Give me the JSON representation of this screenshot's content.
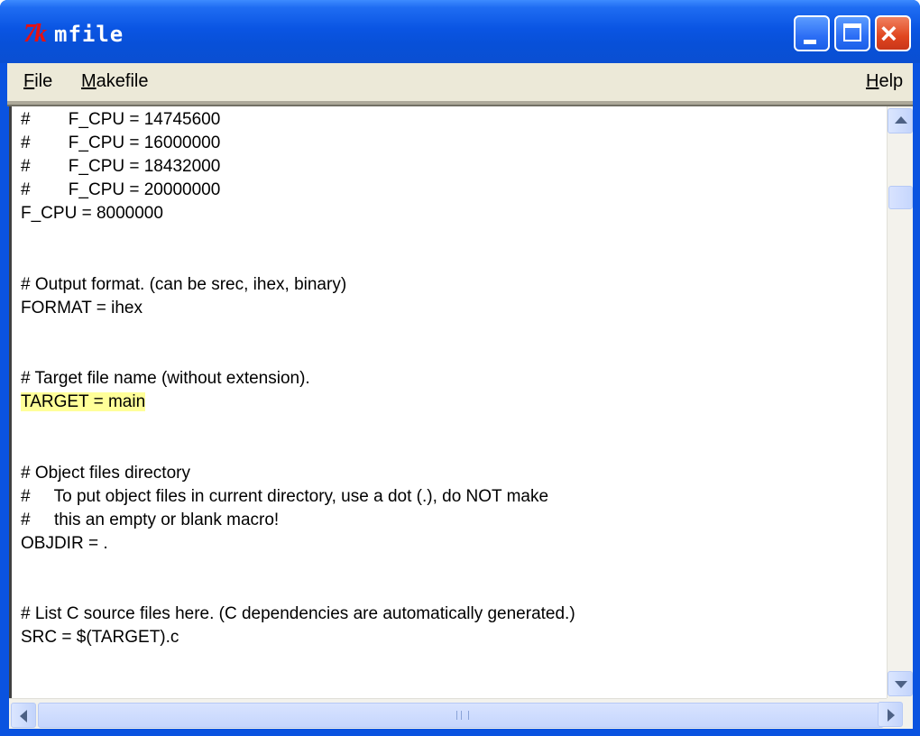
{
  "window": {
    "title": "mfile",
    "app_icon_text": "7k",
    "controls": {
      "minimize": "minimize",
      "maximize": "maximize",
      "close": "×"
    }
  },
  "menubar": {
    "file": {
      "mnemonic": "F",
      "rest": "ile"
    },
    "makefile": {
      "mnemonic": "M",
      "rest": "akefile"
    },
    "help": {
      "mnemonic": "H",
      "rest": "elp"
    }
  },
  "editor": {
    "lines": [
      "#        F_CPU = 14745600",
      "#        F_CPU = 16000000",
      "#        F_CPU = 18432000",
      "#        F_CPU = 20000000",
      "F_CPU = 8000000",
      "",
      "",
      "# Output format. (can be srec, ihex, binary)",
      "FORMAT = ihex",
      "",
      "",
      "# Target file name (without extension).",
      "TARGET = main",
      "",
      "",
      "# Object files directory",
      "#     To put object files in current directory, use a dot (.), do NOT make",
      "#     this an empty or blank macro!",
      "OBJDIR = .",
      "",
      "",
      "# List C source files here. (C dependencies are automatically generated.)",
      "SRC = $(TARGET).c"
    ],
    "highlighted_line_index": 12,
    "highlight_color": "#ffff99"
  },
  "colors": {
    "titlebar": "#0a55e3",
    "menubar": "#ece9d8",
    "close_button": "#e0461f"
  }
}
